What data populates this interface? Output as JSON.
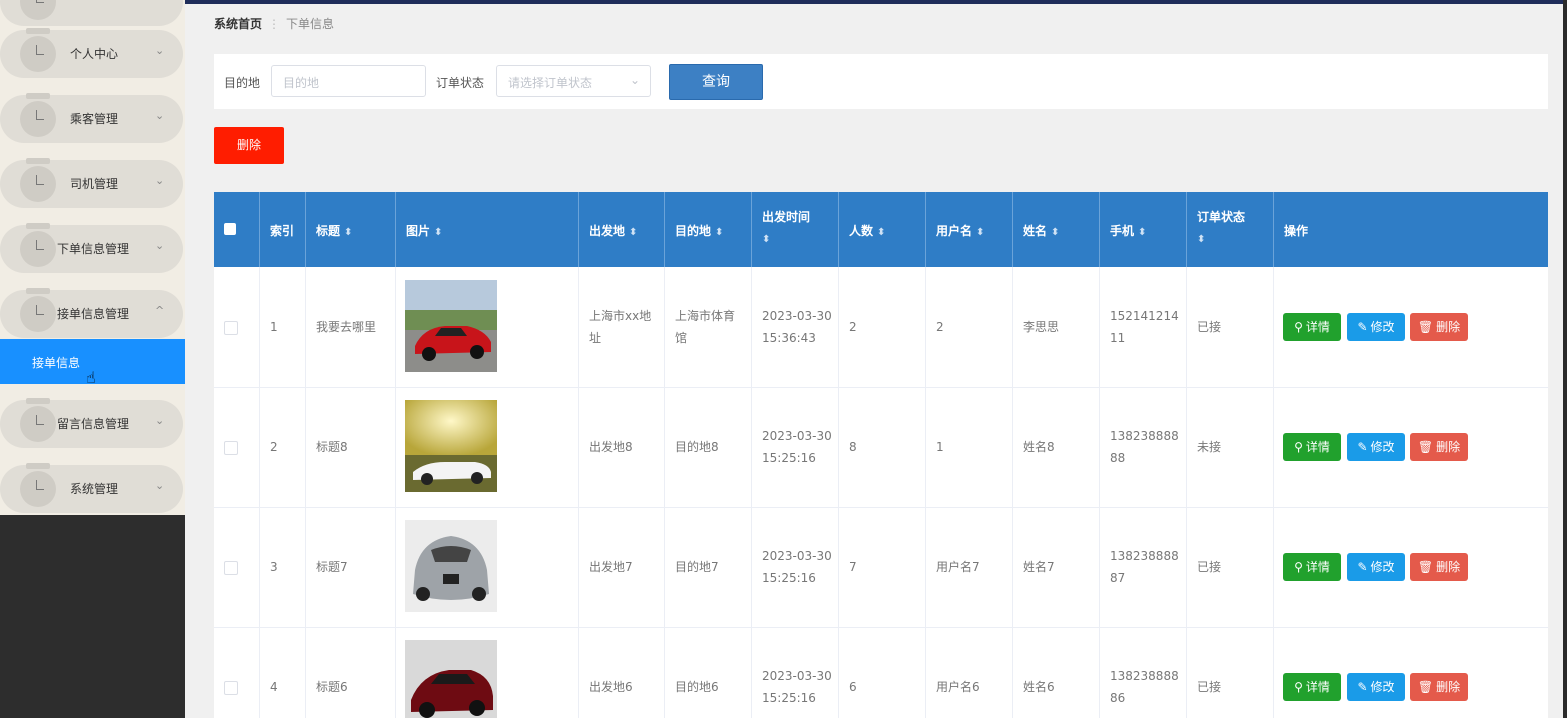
{
  "sidebar": {
    "menu": [
      {
        "label": "个人中心"
      },
      {
        "label": "乘客管理"
      },
      {
        "label": "司机管理"
      },
      {
        "label": "下单信息管理"
      },
      {
        "label": "接单信息管理"
      },
      {
        "label": "留言信息管理"
      },
      {
        "label": "系统管理"
      }
    ],
    "active_sub": "接单信息",
    "chevron_down": "⌄",
    "chevron_up": "^"
  },
  "breadcrumb": {
    "home": "系统首页",
    "sep": "⋮",
    "current": "下单信息"
  },
  "filter": {
    "dest_label": "目的地",
    "dest_placeholder": "目的地",
    "status_label": "订单状态",
    "status_placeholder": "请选择订单状态",
    "query_button": "查询"
  },
  "toolbar": {
    "delete_button": "删除"
  },
  "table": {
    "headers": {
      "index": "索引",
      "title": "标题",
      "image": "图片",
      "origin": "出发地",
      "dest": "目的地",
      "time": "出发时间",
      "people": "人数",
      "username": "用户名",
      "name": "姓名",
      "phone": "手机",
      "status": "订单状态",
      "ops": "操作"
    },
    "sort_glyph": "⬍",
    "rows": [
      {
        "index": "1",
        "title": "我要去哪里",
        "origin": "上海市xx地址",
        "dest": "上海市体育馆",
        "time": "2023-03-30 15:36:43",
        "people": "2",
        "username": "2",
        "name": "李思思",
        "phone": "15214121411",
        "status": "已接",
        "image": "red-sports-car"
      },
      {
        "index": "2",
        "title": "标题8",
        "origin": "出发地8",
        "dest": "目的地8",
        "time": "2023-03-30 15:25:16",
        "people": "8",
        "username": "1",
        "name": "姓名8",
        "phone": "13823888888",
        "status": "未接",
        "image": "white-convertible"
      },
      {
        "index": "3",
        "title": "标题7",
        "origin": "出发地7",
        "dest": "目的地7",
        "time": "2023-03-30 15:25:16",
        "people": "7",
        "username": "用户名7",
        "name": "姓名7",
        "phone": "13823888887",
        "status": "已接",
        "image": "silver-concept-car"
      },
      {
        "index": "4",
        "title": "标题6",
        "origin": "出发地6",
        "dest": "目的地6",
        "time": "2023-03-30 15:25:16",
        "people": "6",
        "username": "用户名6",
        "name": "姓名6",
        "phone": "13823888886",
        "status": "已接",
        "image": "dark-red-sports-car"
      }
    ],
    "actions": {
      "detail": "详情",
      "edit": "修改",
      "delete": "删除"
    }
  },
  "colors": {
    "accent": "#2f7dc6",
    "active": "#1890ff",
    "danger": "#ff1d00",
    "detail": "#21a12d",
    "edit": "#1a9be8",
    "delete": "#e45a4b"
  }
}
